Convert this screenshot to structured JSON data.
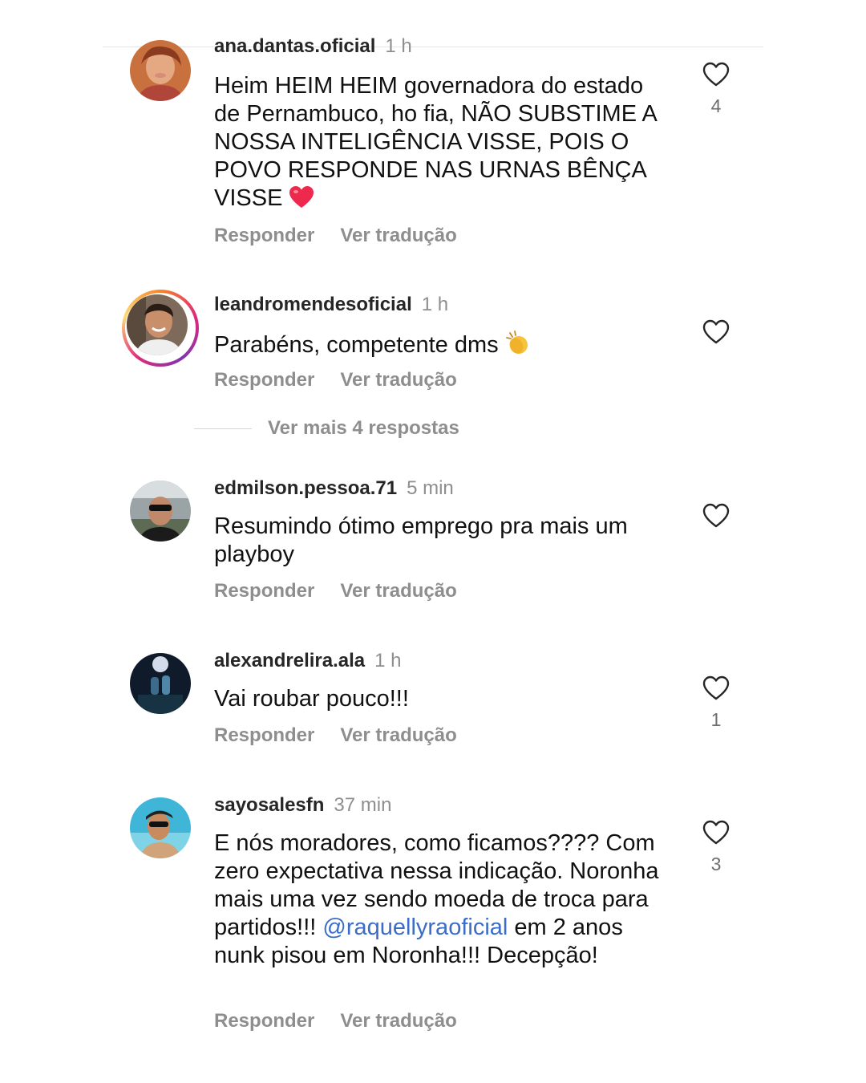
{
  "comments": [
    {
      "username": "ana.dantas.oficial",
      "time": "1 h",
      "text": "Heim HEIM HEIM governadora do estado de Pernambuco,  ho fia, NÃO SUBSTIME A NOSSA INTELIGÊNCIA VISSE,  POIS O POVO RESPONDE NAS URNAS BÊNÇA VISSE",
      "emoji": "red-heart",
      "reply_label": "Responder",
      "translate_label": "Ver tradução",
      "likes": "4"
    },
    {
      "username": "leandromendesoficial",
      "time": "1 h",
      "text": "Parabéns, competente dms",
      "emoji": "clapping-hands",
      "reply_label": "Responder",
      "translate_label": "Ver tradução",
      "likes": ""
    },
    {
      "username": "edmilson.pessoa.71",
      "time": "5 min",
      "text": "Resumindo ótimo emprego pra mais um playboy",
      "reply_label": "Responder",
      "translate_label": "Ver tradução",
      "likes": ""
    },
    {
      "username": "alexandrelira.ala",
      "time": "1 h",
      "text": "Vai roubar pouco!!!",
      "reply_label": "Responder",
      "translate_label": "Ver tradução",
      "likes": "1"
    },
    {
      "username": "sayosalesfn",
      "time": "37 min",
      "text_before": "E nós moradores, como ficamos???? Com zero expectativa nessa indicação. Noronha mais uma vez sendo moeda de troca para partidos!!! ",
      "mention": "@raquellyraoficial",
      "text_after": " em 2 anos nunk pisou em Noronha!!! Decepção!",
      "reply_label": "Responder",
      "translate_label": "Ver tradução",
      "likes": "3"
    }
  ],
  "more_replies_label": "Ver mais 4 respostas",
  "colors": {
    "mention": "#3b6dc7",
    "secondary_text": "#8e8e8e",
    "heart": "#ed2a4d"
  }
}
